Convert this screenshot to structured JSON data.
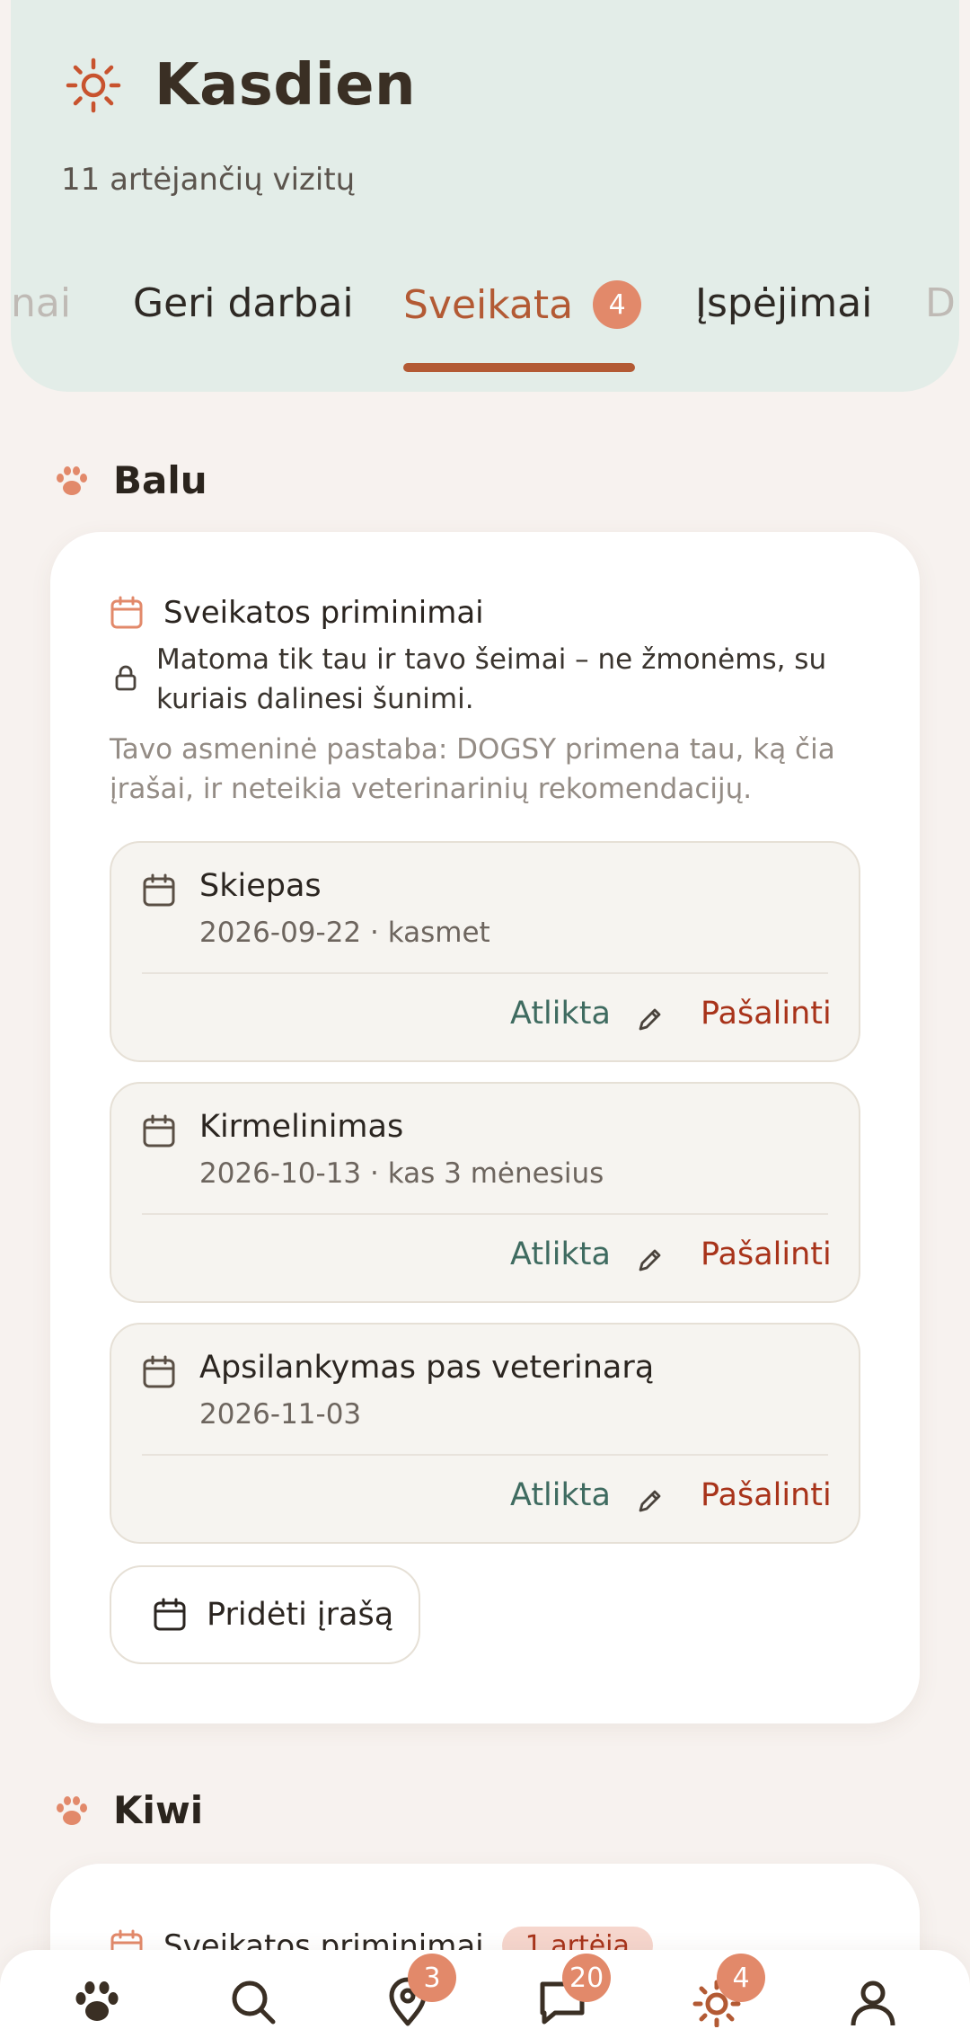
{
  "header": {
    "title": "Kasdien",
    "subtitle": "11 artėjančių vizitų"
  },
  "tabs": [
    {
      "label": "nai",
      "state": "partial"
    },
    {
      "label": "Geri darbai",
      "state": "normal"
    },
    {
      "label": "Sveikata",
      "state": "active",
      "badge": "4"
    },
    {
      "label": "Įspėjimai",
      "state": "normal"
    },
    {
      "label": "D",
      "state": "partial"
    }
  ],
  "pets": [
    {
      "name": "Balu",
      "card": {
        "title": "Sveikatos priminimai",
        "privacy": "Matoma tik tau ir tavo šeimai – ne žmonėms, su kuriais dalinesi šunimi.",
        "note": "Tavo asmeninė pastaba: DOGSY primena tau, ką čia įrašai, ir neteikia veterinarinių rekomendacijų.",
        "reminders": [
          {
            "title": "Skiepas",
            "date": "2026-09-22 · kasmet",
            "done_label": "Atlikta",
            "remove_label": "Pašalinti"
          },
          {
            "title": "Kirmelinimas",
            "date": "2026-10-13 · kas 3 mėnesius",
            "done_label": "Atlikta",
            "remove_label": "Pašalinti"
          },
          {
            "title": "Apsilankymas pas veterinarą",
            "date": "2026-11-03",
            "done_label": "Atlikta",
            "remove_label": "Pašalinti"
          }
        ],
        "add_label": "Pridėti įrašą"
      }
    },
    {
      "name": "Kiwi",
      "card": {
        "title": "Sveikatos priminimai",
        "badge": "1 artėja"
      }
    }
  ],
  "nav": {
    "items": [
      {
        "icon": "paw-icon"
      },
      {
        "icon": "search-icon"
      },
      {
        "icon": "map-pin-icon",
        "badge": "3"
      },
      {
        "icon": "chat-icon",
        "badge": "20"
      },
      {
        "icon": "sun-icon",
        "badge": "4"
      },
      {
        "icon": "profile-icon"
      }
    ]
  },
  "colors": {
    "accent": "#b35a34",
    "badge": "#e2896a",
    "done": "#3f6b60",
    "remove": "#a8331a",
    "header_bg": "#e3ede8"
  }
}
